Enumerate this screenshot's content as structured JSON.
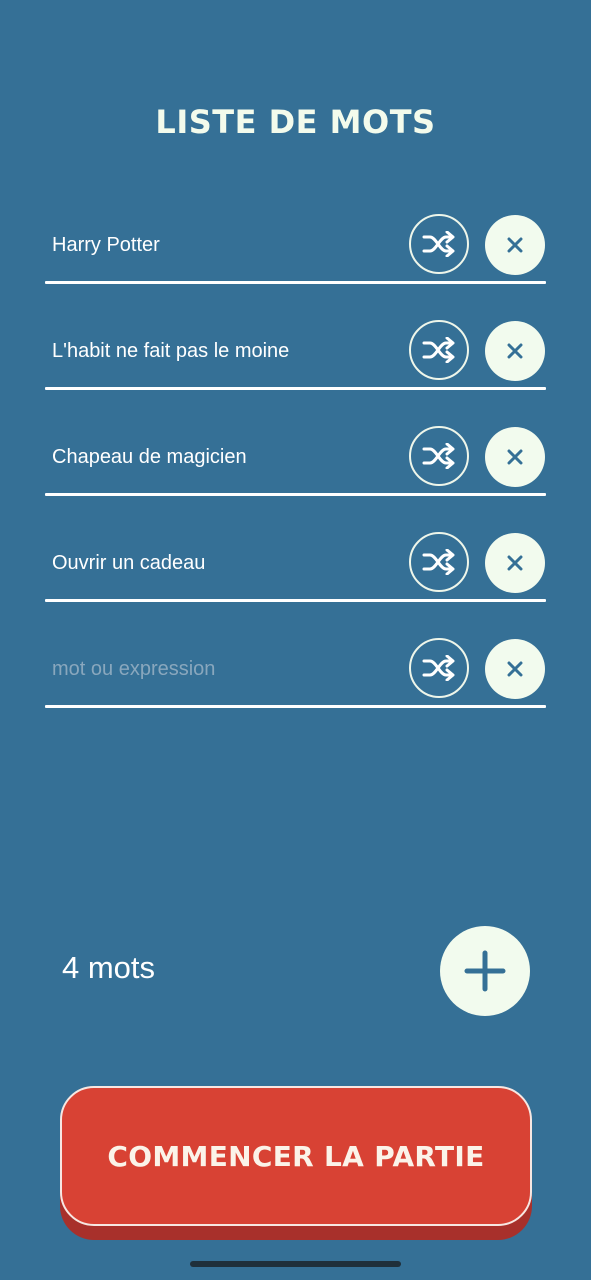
{
  "header": {
    "title": "LISTE DE MOTS"
  },
  "words": [
    {
      "value": "Harry Potter",
      "placeholder": ""
    },
    {
      "value": "L'habit ne fait pas le moine",
      "placeholder": ""
    },
    {
      "value": "Chapeau de magicien",
      "placeholder": ""
    },
    {
      "value": "Ouvrir un cadeau",
      "placeholder": ""
    },
    {
      "value": "",
      "placeholder": "mot ou expression"
    }
  ],
  "footer": {
    "count_label": "4 mots",
    "start_label": "COMMENCER LA PARTIE"
  },
  "icons": {
    "shuffle": "shuffle-icon",
    "delete": "close-icon",
    "add": "plus-icon"
  },
  "colors": {
    "background": "#357096",
    "accent_light": "#f2fbee",
    "start_button": "#d84234",
    "start_button_shadow": "#a8302b"
  }
}
